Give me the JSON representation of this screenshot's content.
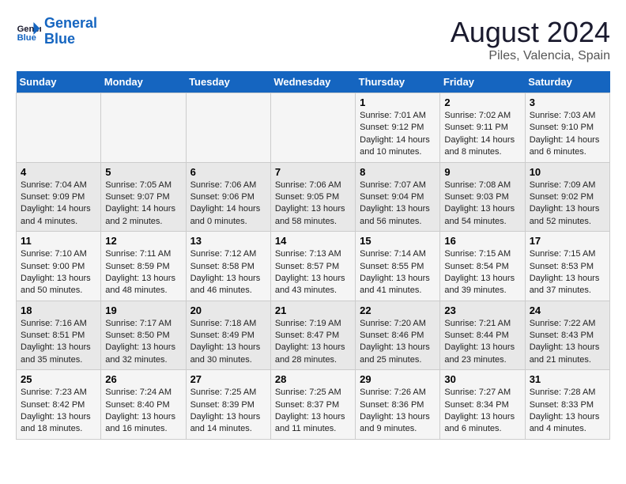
{
  "header": {
    "logo_line1": "General",
    "logo_line2": "Blue",
    "title": "August 2024",
    "subtitle": "Piles, Valencia, Spain"
  },
  "weekdays": [
    "Sunday",
    "Monday",
    "Tuesday",
    "Wednesday",
    "Thursday",
    "Friday",
    "Saturday"
  ],
  "weeks": [
    {
      "days": [
        {
          "num": "",
          "info": ""
        },
        {
          "num": "",
          "info": ""
        },
        {
          "num": "",
          "info": ""
        },
        {
          "num": "",
          "info": ""
        },
        {
          "num": "1",
          "info": "Sunrise: 7:01 AM\nSunset: 9:12 PM\nDaylight: 14 hours and 10 minutes."
        },
        {
          "num": "2",
          "info": "Sunrise: 7:02 AM\nSunset: 9:11 PM\nDaylight: 14 hours and 8 minutes."
        },
        {
          "num": "3",
          "info": "Sunrise: 7:03 AM\nSunset: 9:10 PM\nDaylight: 14 hours and 6 minutes."
        }
      ]
    },
    {
      "days": [
        {
          "num": "4",
          "info": "Sunrise: 7:04 AM\nSunset: 9:09 PM\nDaylight: 14 hours and 4 minutes."
        },
        {
          "num": "5",
          "info": "Sunrise: 7:05 AM\nSunset: 9:07 PM\nDaylight: 14 hours and 2 minutes."
        },
        {
          "num": "6",
          "info": "Sunrise: 7:06 AM\nSunset: 9:06 PM\nDaylight: 14 hours and 0 minutes."
        },
        {
          "num": "7",
          "info": "Sunrise: 7:06 AM\nSunset: 9:05 PM\nDaylight: 13 hours and 58 minutes."
        },
        {
          "num": "8",
          "info": "Sunrise: 7:07 AM\nSunset: 9:04 PM\nDaylight: 13 hours and 56 minutes."
        },
        {
          "num": "9",
          "info": "Sunrise: 7:08 AM\nSunset: 9:03 PM\nDaylight: 13 hours and 54 minutes."
        },
        {
          "num": "10",
          "info": "Sunrise: 7:09 AM\nSunset: 9:02 PM\nDaylight: 13 hours and 52 minutes."
        }
      ]
    },
    {
      "days": [
        {
          "num": "11",
          "info": "Sunrise: 7:10 AM\nSunset: 9:00 PM\nDaylight: 13 hours and 50 minutes."
        },
        {
          "num": "12",
          "info": "Sunrise: 7:11 AM\nSunset: 8:59 PM\nDaylight: 13 hours and 48 minutes."
        },
        {
          "num": "13",
          "info": "Sunrise: 7:12 AM\nSunset: 8:58 PM\nDaylight: 13 hours and 46 minutes."
        },
        {
          "num": "14",
          "info": "Sunrise: 7:13 AM\nSunset: 8:57 PM\nDaylight: 13 hours and 43 minutes."
        },
        {
          "num": "15",
          "info": "Sunrise: 7:14 AM\nSunset: 8:55 PM\nDaylight: 13 hours and 41 minutes."
        },
        {
          "num": "16",
          "info": "Sunrise: 7:15 AM\nSunset: 8:54 PM\nDaylight: 13 hours and 39 minutes."
        },
        {
          "num": "17",
          "info": "Sunrise: 7:15 AM\nSunset: 8:53 PM\nDaylight: 13 hours and 37 minutes."
        }
      ]
    },
    {
      "days": [
        {
          "num": "18",
          "info": "Sunrise: 7:16 AM\nSunset: 8:51 PM\nDaylight: 13 hours and 35 minutes."
        },
        {
          "num": "19",
          "info": "Sunrise: 7:17 AM\nSunset: 8:50 PM\nDaylight: 13 hours and 32 minutes."
        },
        {
          "num": "20",
          "info": "Sunrise: 7:18 AM\nSunset: 8:49 PM\nDaylight: 13 hours and 30 minutes."
        },
        {
          "num": "21",
          "info": "Sunrise: 7:19 AM\nSunset: 8:47 PM\nDaylight: 13 hours and 28 minutes."
        },
        {
          "num": "22",
          "info": "Sunrise: 7:20 AM\nSunset: 8:46 PM\nDaylight: 13 hours and 25 minutes."
        },
        {
          "num": "23",
          "info": "Sunrise: 7:21 AM\nSunset: 8:44 PM\nDaylight: 13 hours and 23 minutes."
        },
        {
          "num": "24",
          "info": "Sunrise: 7:22 AM\nSunset: 8:43 PM\nDaylight: 13 hours and 21 minutes."
        }
      ]
    },
    {
      "days": [
        {
          "num": "25",
          "info": "Sunrise: 7:23 AM\nSunset: 8:42 PM\nDaylight: 13 hours and 18 minutes."
        },
        {
          "num": "26",
          "info": "Sunrise: 7:24 AM\nSunset: 8:40 PM\nDaylight: 13 hours and 16 minutes."
        },
        {
          "num": "27",
          "info": "Sunrise: 7:25 AM\nSunset: 8:39 PM\nDaylight: 13 hours and 14 minutes."
        },
        {
          "num": "28",
          "info": "Sunrise: 7:25 AM\nSunset: 8:37 PM\nDaylight: 13 hours and 11 minutes."
        },
        {
          "num": "29",
          "info": "Sunrise: 7:26 AM\nSunset: 8:36 PM\nDaylight: 13 hours and 9 minutes."
        },
        {
          "num": "30",
          "info": "Sunrise: 7:27 AM\nSunset: 8:34 PM\nDaylight: 13 hours and 6 minutes."
        },
        {
          "num": "31",
          "info": "Sunrise: 7:28 AM\nSunset: 8:33 PM\nDaylight: 13 hours and 4 minutes."
        }
      ]
    }
  ]
}
